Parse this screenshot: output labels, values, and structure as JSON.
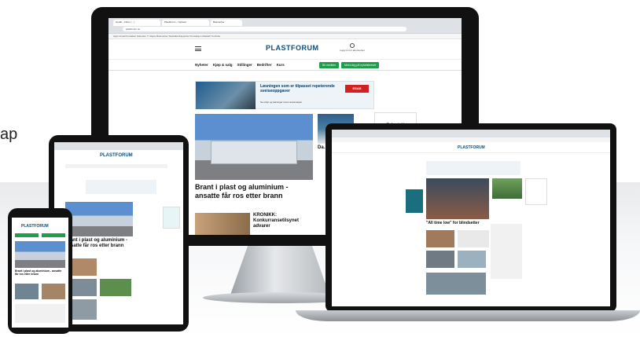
{
  "side_text": "ap",
  "monitor": {
    "tabs": [
      "Gmail – Inbox (…)",
      "Plastforum – Nyheter",
      "Bokmerker",
      "+"
    ],
    "url": "plastforum.no",
    "bookmarks": "Apps  Gmail  Kontakter  Kalender  Yr  Rejse  Bokmerker  Statistikk  Rapporter  Produksjon  Mediefil  YouTube",
    "logo": "PLASTFORUM",
    "login": "Logg inn for abonnenter",
    "nav": [
      "Nyheter",
      "Kjøp & salg",
      "Stillinger",
      "Bedrifter",
      "Kurs"
    ],
    "btn_green_1": "Bli medlem",
    "btn_green_2": "Meld deg på nyhetsbrevet",
    "ad_title": "Løsningen som er tilpasset repeterende sveiseoppgaver",
    "ad_sub": "Se utdyr og løsninger innen automasjon",
    "ad_brand": "ESAB",
    "headline": "Brant i plast og aluminium - ansatte får ros etter brann",
    "side_story": "Da… rek…",
    "kronikk": "KRONIKK: Konkurransetilsynet advarer",
    "contact": "Ta kontakt"
  },
  "laptop": {
    "logo": "PLASTFORUM",
    "headline": "\"All time low\" for blindsetter"
  },
  "tablet": {
    "logo": "PLASTFORUM",
    "headline": "Brant i plast og aluminium - ansatte får ros etter brann"
  },
  "phone": {
    "logo": "PLASTFORUM",
    "headline": "Brant i plast og aluminium - ansatte får ros etter brann"
  }
}
